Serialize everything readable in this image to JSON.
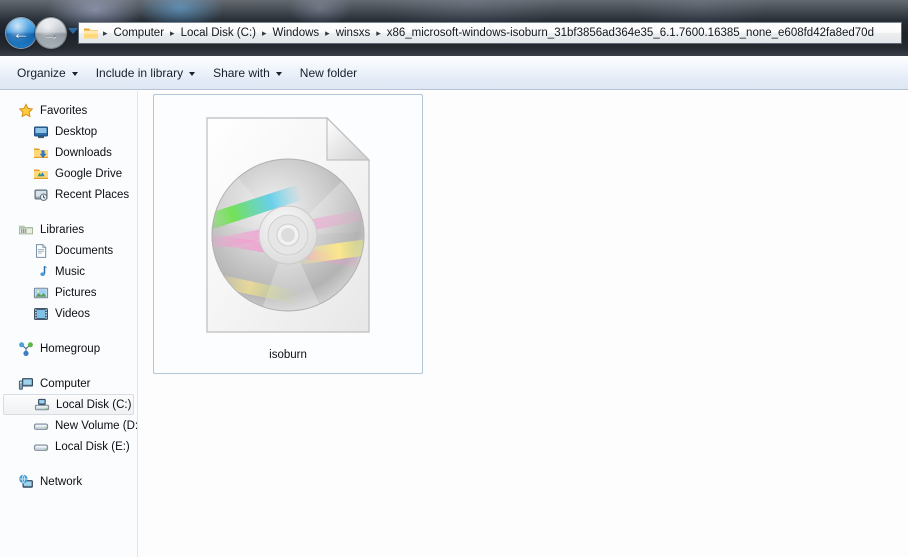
{
  "window": {
    "title": "x86_microsoft-windows-isoburn_31bf3856ad364e35_6.1.7600.16385_none_e608fd42fa8ed70d",
    "glass_color": "#242a32",
    "accent_color": "#2a8ad6"
  },
  "nav": {
    "back_glyph": "←",
    "back_label": "Back",
    "forward_glyph": "→",
    "forward_label": "Forward",
    "history_label": "Recent pages"
  },
  "address": {
    "folder_icon": "folder-icon",
    "separator": "▸",
    "crumbs": [
      {
        "label": "Computer"
      },
      {
        "label": "Local Disk (C:)"
      },
      {
        "label": "Windows"
      },
      {
        "label": "winsxs"
      },
      {
        "label": "x86_microsoft-windows-isoburn_31bf3856ad364e35_6.1.7600.16385_none_e608fd42fa8ed70d"
      }
    ]
  },
  "toolbar": {
    "items": [
      {
        "label": "Organize",
        "has_caret": true
      },
      {
        "label": "Include in library",
        "has_caret": true
      },
      {
        "label": "Share with",
        "has_caret": true
      },
      {
        "label": "New folder",
        "has_caret": false
      }
    ]
  },
  "sidebar": {
    "groups": [
      {
        "header": {
          "label": "Favorites",
          "icon": "star-icon"
        },
        "items": [
          {
            "label": "Desktop",
            "icon": "desktop-icon"
          },
          {
            "label": "Downloads",
            "icon": "downloads-folder-icon"
          },
          {
            "label": "Google Drive",
            "icon": "google-drive-folder-icon"
          },
          {
            "label": "Recent Places",
            "icon": "recent-places-icon"
          }
        ]
      },
      {
        "header": {
          "label": "Libraries",
          "icon": "libraries-icon"
        },
        "items": [
          {
            "label": "Documents",
            "icon": "documents-icon"
          },
          {
            "label": "Music",
            "icon": "music-note-icon"
          },
          {
            "label": "Pictures",
            "icon": "pictures-icon"
          },
          {
            "label": "Videos",
            "icon": "videos-film-icon"
          }
        ]
      },
      {
        "header": {
          "label": "Homegroup",
          "icon": "homegroup-icon"
        },
        "items": []
      },
      {
        "header": {
          "label": "Computer",
          "icon": "computer-icon"
        },
        "items": [
          {
            "label": "Local Disk (C:)",
            "icon": "system-drive-icon",
            "selected": true
          },
          {
            "label": "New Volume (D:",
            "icon": "drive-icon",
            "selected": false
          },
          {
            "label": "Local Disk (E:)",
            "icon": "drive-icon",
            "selected": false
          }
        ]
      },
      {
        "header": {
          "label": "Network",
          "icon": "network-icon"
        },
        "items": []
      }
    ]
  },
  "content": {
    "files": [
      {
        "name": "isoburn",
        "icon": "disc-document-icon",
        "selected": true
      }
    ]
  }
}
